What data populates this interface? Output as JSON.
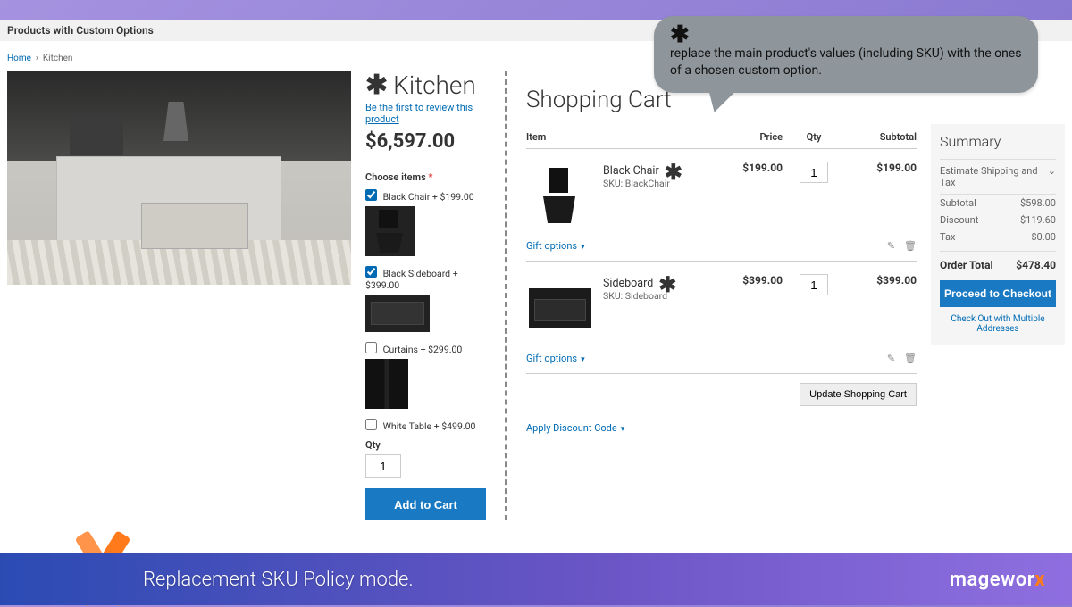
{
  "header": {
    "title": "Products with Custom Options"
  },
  "breadcrumbs": {
    "home": "Home",
    "current": "Kitchen"
  },
  "product": {
    "title": "Kitchen",
    "review_link": "Be the first to review this product",
    "price": "$6,597.00",
    "choose_label": "Choose items",
    "options": [
      {
        "label": "Black Chair + $199.00",
        "checked": true,
        "kind": "chair"
      },
      {
        "label": "Black Sideboard + $399.00",
        "checked": true,
        "kind": "sideboard"
      },
      {
        "label": "Curtains + $299.00",
        "checked": false,
        "kind": "curtains"
      },
      {
        "label": "White Table + $499.00",
        "checked": false,
        "kind": "none"
      }
    ],
    "qty_label": "Qty",
    "qty_value": "1",
    "add_to_cart": "Add to Cart"
  },
  "cart": {
    "title": "Shopping Cart",
    "columns": {
      "item": "Item",
      "price": "Price",
      "qty": "Qty",
      "subtotal": "Subtotal"
    },
    "items": [
      {
        "name": "Black Chair",
        "sku": "SKU: BlackChair",
        "price": "$199.00",
        "qty": "1",
        "subtotal": "$199.00",
        "kind": "chair"
      },
      {
        "name": "Sideboard",
        "sku": "SKU: Sideboard",
        "price": "$399.00",
        "qty": "1",
        "subtotal": "$399.00",
        "kind": "sideboard"
      }
    ],
    "gift_options": "Gift options",
    "update_cart": "Update Shopping Cart",
    "discount": "Apply Discount Code"
  },
  "summary": {
    "title": "Summary",
    "estimate": "Estimate Shipping and Tax",
    "subtotal_l": "Subtotal",
    "subtotal_v": "$598.00",
    "discount_l": "Discount",
    "discount_v": "-$119.60",
    "tax_l": "Tax",
    "tax_v": "$0.00",
    "order_total_l": "Order Total",
    "order_total_v": "$478.40",
    "checkout": "Proceed to Checkout",
    "multiship": "Check Out with Multiple Addresses"
  },
  "callout": {
    "text": "replace the main product's values (including SKU) with the ones of a chosen custom option."
  },
  "footer": {
    "caption": "Replacement  SKU Policy mode.",
    "brand_a": "magewor",
    "brand_b": "x"
  }
}
